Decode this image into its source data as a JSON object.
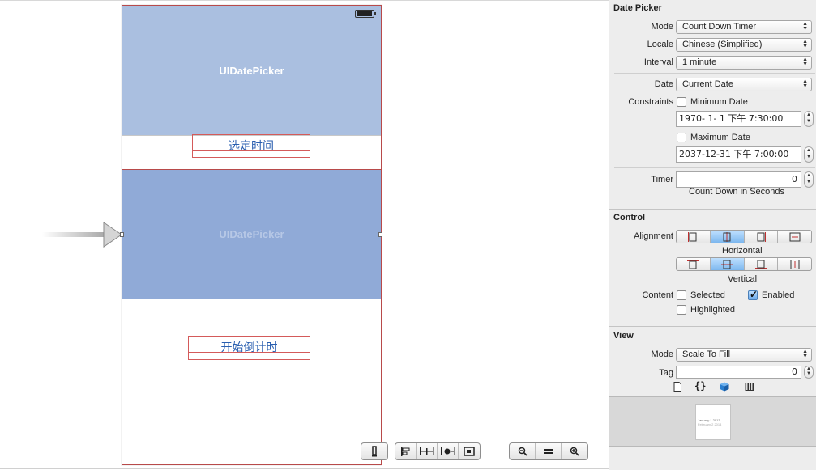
{
  "canvas": {
    "picker_top_label": "UIDatePicker",
    "picker_bottom_label": "UIDatePicker",
    "select_time_label": "选定时间",
    "start_countdown_label": "开始倒计时"
  },
  "canvas_toolbar": {
    "groups": [
      [
        "resize-device-icon"
      ],
      [
        "align-icon",
        "pin-icon",
        "resolve-icon",
        "resizing-icon"
      ],
      [
        "zoom-out-icon",
        "zoom-actual-icon",
        "zoom-in-icon"
      ]
    ]
  },
  "inspector": {
    "date_picker": {
      "title": "Date Picker",
      "mode_label": "Mode",
      "mode_value": "Count Down Timer",
      "locale_label": "Locale",
      "locale_value": "Chinese (Simplified)",
      "interval_label": "Interval",
      "interval_value": "1 minute",
      "date_label": "Date",
      "date_value": "Current Date",
      "constraints_label": "Constraints",
      "minimum_date_label": "Minimum Date",
      "minimum_date_checked": false,
      "minimum_date_value": "1970- 1- 1 下午 7:30:00",
      "maximum_date_label": "Maximum Date",
      "maximum_date_checked": false,
      "maximum_date_value": "2037-12-31 下午 7:00:00",
      "timer_label": "Timer",
      "timer_value": "0",
      "timer_caption": "Count Down in Seconds"
    },
    "control": {
      "title": "Control",
      "alignment_label": "Alignment",
      "horizontal_caption": "Horizontal",
      "vertical_caption": "Vertical",
      "horizontal_selected": 1,
      "vertical_selected": 1,
      "content_label": "Content",
      "selected_label": "Selected",
      "selected_checked": false,
      "enabled_label": "Enabled",
      "enabled_checked": true,
      "highlighted_label": "Highlighted",
      "highlighted_checked": false
    },
    "view": {
      "title": "View",
      "mode_label": "Mode",
      "mode_value": "Scale To Fill",
      "tag_label": "Tag",
      "tag_value": "0"
    },
    "bottom_tabs": [
      "file-template-icon",
      "code-snippet-icon",
      "object-library-icon",
      "media-library-icon"
    ],
    "library_item": {
      "row1": "January  1  2013",
      "row2": "February  2  2014"
    }
  }
}
